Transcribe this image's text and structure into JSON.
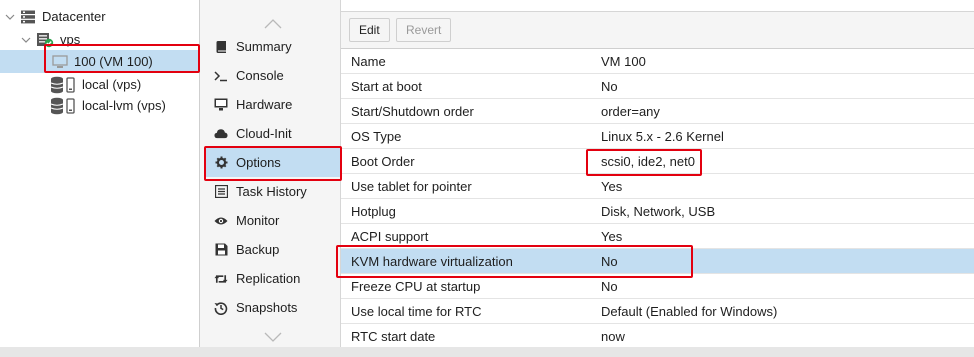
{
  "tree": {
    "datacenter": {
      "label": "Datacenter",
      "icon": "datacenter-icon"
    },
    "node": {
      "label": "vps",
      "icon": "server-online-icon"
    },
    "vm": {
      "label": "100 (VM 100)",
      "icon": "monitor-icon"
    },
    "storage_local": {
      "label": "local (vps)",
      "icon": "storage-icon"
    },
    "storage_lvm": {
      "label": "local-lvm (vps)",
      "icon": "storage-icon"
    }
  },
  "nav": {
    "items": [
      {
        "label": "Summary",
        "icon": "book-icon"
      },
      {
        "label": "Console",
        "icon": "terminal-icon"
      },
      {
        "label": "Hardware",
        "icon": "desktop-icon"
      },
      {
        "label": "Cloud-Init",
        "icon": "cloud-icon"
      },
      {
        "label": "Options",
        "icon": "gear-icon"
      },
      {
        "label": "Task History",
        "icon": "list-icon"
      },
      {
        "label": "Monitor",
        "icon": "eye-icon"
      },
      {
        "label": "Backup",
        "icon": "floppy-icon"
      },
      {
        "label": "Replication",
        "icon": "retweet-icon"
      },
      {
        "label": "Snapshots",
        "icon": "history-icon"
      }
    ],
    "selected": "Options"
  },
  "toolbar": {
    "edit_label": "Edit",
    "revert_label": "Revert"
  },
  "options": [
    {
      "key": "Name",
      "value": "VM 100"
    },
    {
      "key": "Start at boot",
      "value": "No"
    },
    {
      "key": "Start/Shutdown order",
      "value": "order=any"
    },
    {
      "key": "OS Type",
      "value": "Linux 5.x - 2.6 Kernel"
    },
    {
      "key": "Boot Order",
      "value": "scsi0, ide2, net0"
    },
    {
      "key": "Use tablet for pointer",
      "value": "Yes"
    },
    {
      "key": "Hotplug",
      "value": "Disk, Network, USB"
    },
    {
      "key": "ACPI support",
      "value": "Yes"
    },
    {
      "key": "KVM hardware virtualization",
      "value": "No"
    },
    {
      "key": "Freeze CPU at startup",
      "value": "No"
    },
    {
      "key": "Use local time for RTC",
      "value": "Default (Enabled for Windows)"
    },
    {
      "key": "RTC start date",
      "value": "now"
    }
  ],
  "colors": {
    "selection": "#c2ddf2",
    "highlight": "#e3000f",
    "online": "#2ea44f"
  }
}
